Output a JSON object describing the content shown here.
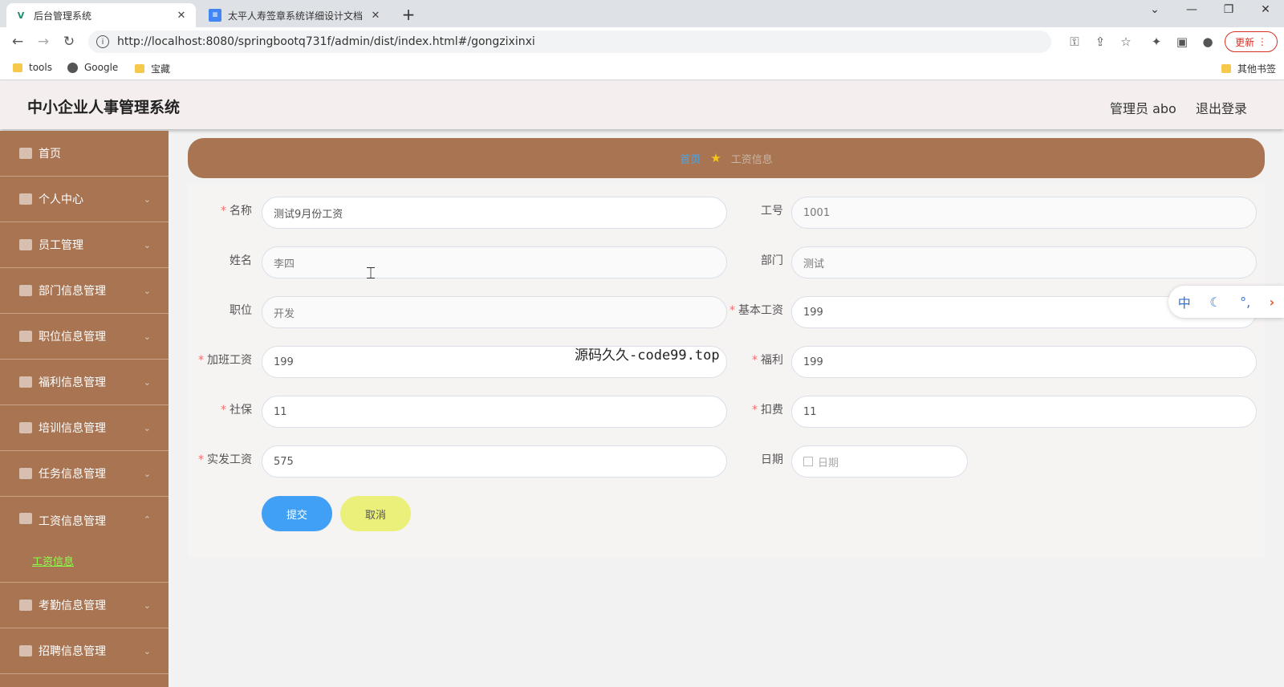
{
  "browser": {
    "tabs": [
      {
        "title": "后台管理系统",
        "active": true
      },
      {
        "title": "太平人寿签章系统详细设计文档",
        "active": false
      }
    ],
    "url": "http://localhost:8080/springbootq731f/admin/dist/index.html#/gongzixinxi",
    "update_label": "更新",
    "bookmarks": [
      "tools",
      "Google",
      "宝藏"
    ],
    "other_bookmarks": "其他书签"
  },
  "header": {
    "title": "中小企业人事管理系统",
    "user": "管理员 abo",
    "logout": "退出登录"
  },
  "sidebar": {
    "items": [
      {
        "label": "首页"
      },
      {
        "label": "个人中心"
      },
      {
        "label": "员工管理"
      },
      {
        "label": "部门信息管理"
      },
      {
        "label": "职位信息管理"
      },
      {
        "label": "福利信息管理"
      },
      {
        "label": "培训信息管理"
      },
      {
        "label": "任务信息管理"
      },
      {
        "label": "工资信息管理",
        "sub": "工资信息"
      },
      {
        "label": "考勤信息管理"
      },
      {
        "label": "招聘信息管理"
      }
    ]
  },
  "breadcrumb": {
    "home": "首页",
    "current": "工资信息"
  },
  "form": {
    "name_label": "名称",
    "name_value": "测试9月份工资",
    "empno_label": "工号",
    "empno_value": "1001",
    "empname_label": "姓名",
    "empname_value": "李四",
    "dept_label": "部门",
    "dept_value": "测试",
    "position_label": "职位",
    "position_value": "开发",
    "basesalary_label": "基本工资",
    "basesalary_value": "199",
    "overtime_label": "加班工资",
    "overtime_value": "199",
    "welfare_label": "福利",
    "welfare_value": "199",
    "social_label": "社保",
    "social_value": "11",
    "deduction_label": "扣费",
    "deduction_value": "11",
    "actual_label": "实发工资",
    "actual_value": "575",
    "date_label": "日期",
    "date_placeholder": "日期",
    "submit_label": "提交",
    "cancel_label": "取消"
  },
  "ime": {
    "mode": "中"
  },
  "overlay": {
    "text": "源码久久-code99.top"
  }
}
